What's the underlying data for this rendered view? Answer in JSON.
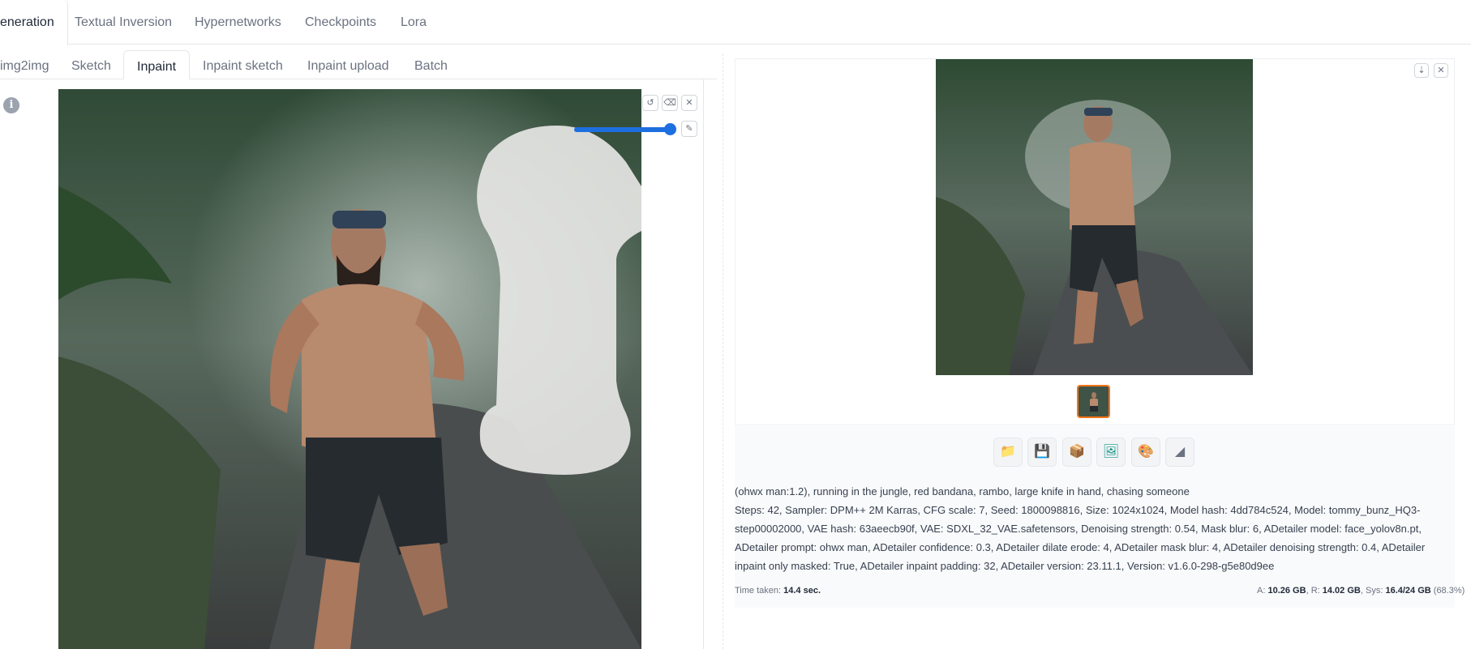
{
  "top_tabs": [
    "eneration",
    "Textual Inversion",
    "Hypernetworks",
    "Checkpoints",
    "Lora"
  ],
  "sub_tabs": [
    "img2img",
    "Sketch",
    "Inpaint",
    "Inpaint sketch",
    "Inpaint upload",
    "Batch"
  ],
  "editor": {
    "info_icon": "info-icon",
    "tools": [
      "undo-icon",
      "eraser-icon",
      "close-icon",
      "brush-icon"
    ],
    "brush_size_fraction": 0.95
  },
  "output": {
    "corner_icons": [
      "download-icon",
      "close-icon"
    ],
    "action_icons": [
      "folder-icon",
      "save-icon",
      "zip-icon",
      "send-to-img2img-icon",
      "send-to-inpaint-icon",
      "send-to-extras-icon"
    ],
    "prompt": "(ohwx man:1.2), running in the jungle, red bandana, rambo, large knife in hand, chasing someone",
    "params": "Steps: 42, Sampler: DPM++ 2M Karras, CFG scale: 7, Seed: 1800098816, Size: 1024x1024, Model hash: 4dd784c524, Model: tommy_bunz_HQ3-step00002000, VAE hash: 63aeecb90f, VAE: SDXL_32_VAE.safetensors, Denoising strength: 0.54, Mask blur: 6, ADetailer model: face_yolov8n.pt, ADetailer prompt: ohwx man, ADetailer confidence: 0.3, ADetailer dilate erode: 4, ADetailer mask blur: 4, ADetailer denoising strength: 0.4, ADetailer inpaint only masked: True, ADetailer inpaint padding: 32, ADetailer version: 23.11.1, Version: v1.6.0-298-g5e80d9ee",
    "time_label": "Time taken:",
    "time_value": "14.4 sec.",
    "vram": {
      "a_label": "A",
      "a_value": "10.26 GB",
      "r_label": "R",
      "r_value": "14.02 GB",
      "sys_label": "Sys",
      "sys_value": "16.4/24 GB",
      "sys_pct": "(68.3%)"
    }
  },
  "colors": {
    "accent_orange": "#f97316",
    "slider_blue": "#1d6fe0"
  }
}
